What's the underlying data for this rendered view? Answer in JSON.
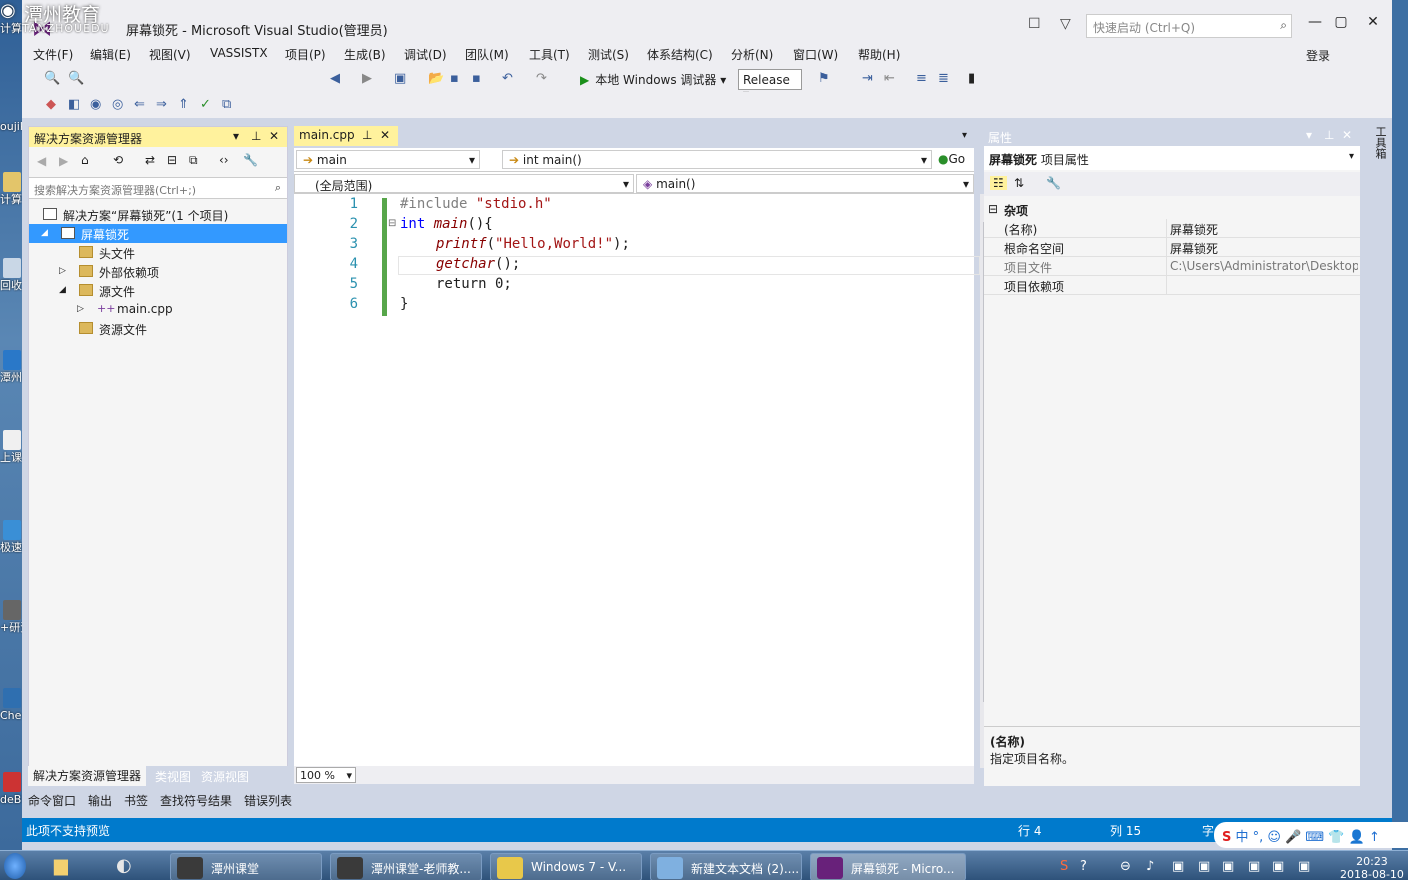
{
  "watermark": {
    "cn": "潭州教育",
    "en": "TANZHOUEDU"
  },
  "window": {
    "title": "屏幕锁死 - Microsoft Visual Studio(管理员)",
    "quick_launch_placeholder": "快速启动 (Ctrl+Q)",
    "login": "登录"
  },
  "menu": [
    "文件(F)",
    "编辑(E)",
    "视图(V)",
    "VASSISTX",
    "项目(P)",
    "生成(B)",
    "调试(D)",
    "团队(M)",
    "工具(T)",
    "测试(S)",
    "体系结构(C)",
    "分析(N)",
    "窗口(W)",
    "帮助(H)"
  ],
  "toolbar": {
    "run_label": "本地 Windows 调试器",
    "config": "Release"
  },
  "solution_explorer": {
    "title": "解决方案资源管理器",
    "search_placeholder": "搜索解决方案资源管理器(Ctrl+;)",
    "items": [
      {
        "label": "解决方案“屏幕锁死”(1 个项目)"
      },
      {
        "label": "屏幕锁死"
      },
      {
        "label": "头文件"
      },
      {
        "label": "外部依赖项"
      },
      {
        "label": "源文件"
      },
      {
        "label": "main.cpp"
      },
      {
        "label": "资源文件"
      }
    ],
    "tabs": [
      "解决方案资源管理器",
      "类视图",
      "资源视图"
    ]
  },
  "editor": {
    "tab": "main.cpp",
    "nav1_left": "main",
    "nav1_right": "int main()",
    "go": "Go",
    "nav2_left": "(全局范围)",
    "nav2_right": "main()",
    "line_numbers": [
      "1",
      "2",
      "3",
      "4",
      "5",
      "6"
    ],
    "zoom": "100 %"
  },
  "code": {
    "l1_pp": "#include ",
    "l1_str": "\"stdio.h\"",
    "l2_kw": "int ",
    "l2_fn": "main",
    "l2_rest": "(){",
    "l3_fn": "printf",
    "l3_a": "(",
    "l3_str": "\"Hello,World!\"",
    "l3_b": ");",
    "l4_fn": "getchar",
    "l4_rest": "();",
    "l5": "return 0;",
    "l6": "}"
  },
  "properties": {
    "title": "属性",
    "selector_name": "屏幕锁死",
    "selector_type": "项目属性",
    "category": "杂项",
    "rows": [
      {
        "key": "(名称)",
        "value": "屏幕锁死"
      },
      {
        "key": "根命名空间",
        "value": "屏幕锁死"
      },
      {
        "key": "项目文件",
        "value": "C:\\Users\\Administrator\\Desktop\\"
      },
      {
        "key": "项目依赖项",
        "value": ""
      }
    ],
    "desc_title": "(名称)",
    "desc_text": "指定项目名称。"
  },
  "right_strip_label": "工具箱",
  "bottom_tabs": [
    "命令窗口",
    "输出",
    "书签",
    "查找符号结果",
    "错误列表"
  ],
  "status": {
    "message": "此项不支持预览",
    "line": "行 4",
    "col": "列 15",
    "char": "字"
  },
  "ime": {
    "brand": "S",
    "text": "中 °, ☺ 🎤 ⌨ 👕 👤 ↑"
  },
  "desktop_icons": [
    "计算",
    "oujik",
    "计算",
    "回收",
    "潭州",
    "上课",
    "极速器",
    "+研资力",
    "Che Engi",
    "deB"
  ],
  "taskbar": {
    "tasks": [
      "潭州课堂",
      "潭州课堂-老师教...",
      "Windows 7 - V...",
      "新建文本文档 (2)....",
      "屏幕锁死 - Micro..."
    ],
    "time": "20:23",
    "date": "2018-08-10"
  }
}
